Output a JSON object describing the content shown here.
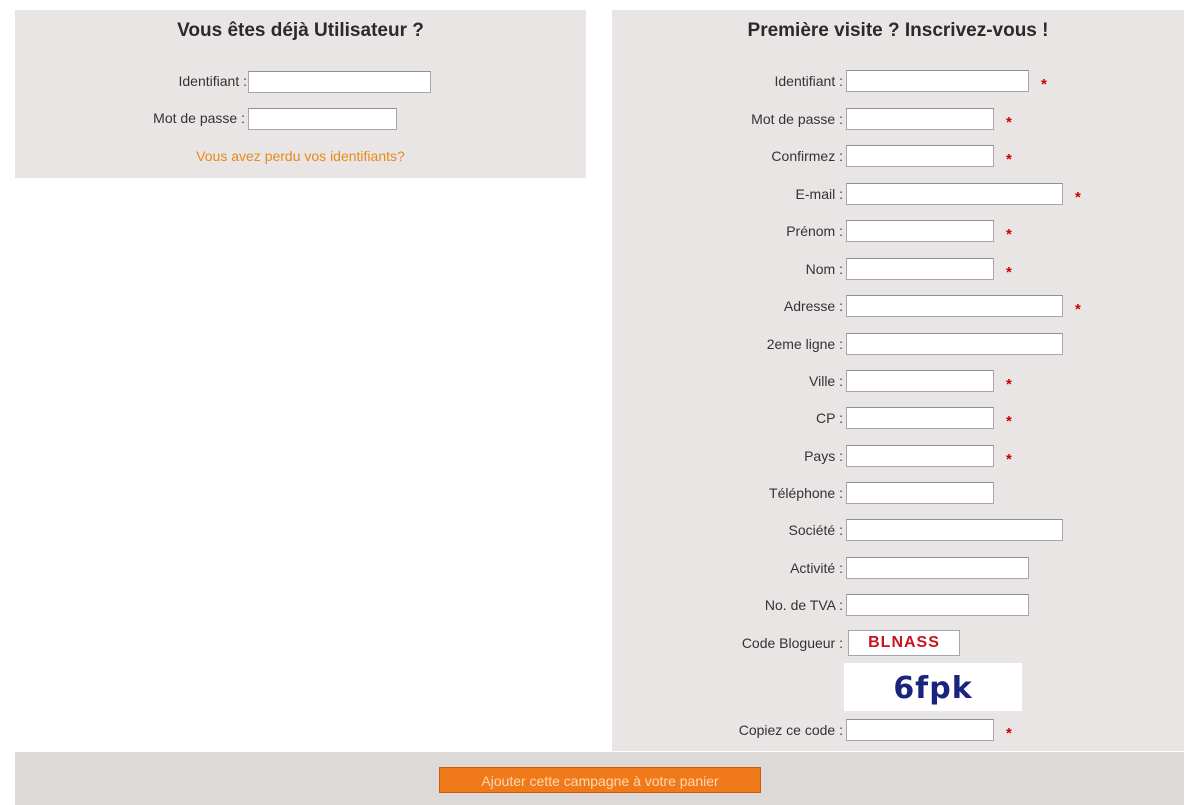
{
  "login": {
    "title": "Vous êtes déjà Utilisateur ?",
    "fields": {
      "identifiant_label": "Identifiant :",
      "password_label": "Mot de passe :"
    },
    "forgot_link": "Vous avez perdu vos identifiants?"
  },
  "register": {
    "title": "Première visite ? Inscrivez-vous !",
    "labels": {
      "identifiant": "Identifiant :",
      "password": "Mot de passe :",
      "confirm": "Confirmez :",
      "email": "E-mail :",
      "prenom": "Prénom :",
      "nom": "Nom :",
      "adresse": "Adresse :",
      "ligne2": "2eme ligne :",
      "ville": "Ville :",
      "cp": "CP :",
      "pays": "Pays :",
      "telephone": "Téléphone :",
      "societe": "Société :",
      "activite": "Activité :",
      "tva": "No. de TVA :",
      "blogger": "Code Blogueur :",
      "copy_code": "Copiez ce code :"
    },
    "required_mark": "*",
    "blogger_code": "BLNASS",
    "captcha_text": "6fpk"
  },
  "submit_label": "Ajouter cette campagne à votre panier",
  "colors": {
    "panel_bg": "#e8e5e4",
    "accent_orange": "#f07a1a",
    "required_red": "#cc0000",
    "link_orange": "#e88a1a"
  }
}
